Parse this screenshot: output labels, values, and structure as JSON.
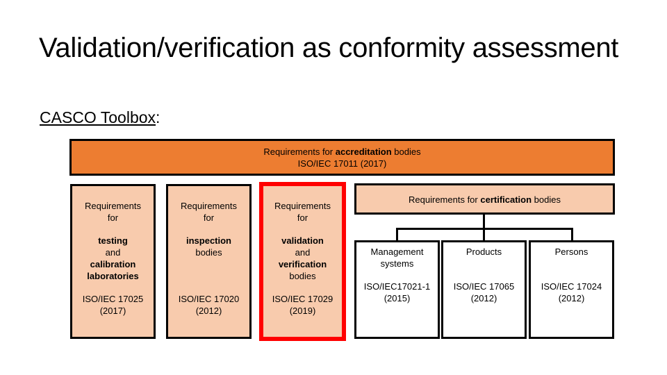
{
  "title": "Validation/verification as conformity assessment",
  "subtitle": {
    "label": "CASCO Toolbox",
    "suffix": ":"
  },
  "diagram": {
    "accreditation": {
      "prefix": "Requirements for ",
      "keyword": "accreditation",
      "suffix": " bodies",
      "standard": "ISO/IEC 17011 (2017)"
    },
    "columns": [
      {
        "intro1": "Requirements",
        "intro2": "for",
        "k1": "testing",
        "mid": "and",
        "k2": "calibration",
        "k3": "laboratories",
        "standard": "ISO/IEC 17025",
        "year": "(2017)"
      },
      {
        "intro1": "Requirements",
        "intro2": "for",
        "k1": "inspection",
        "mid": "bodies",
        "standard": "ISO/IEC 17020",
        "year": "(2012)"
      },
      {
        "intro1": "Requirements",
        "intro2": "for",
        "k1": "validation",
        "mid": "and",
        "k2": "verification",
        "tail": "bodies",
        "standard": "ISO/IEC 17029",
        "year": "(2019)",
        "highlighted": true,
        "highlight_color": "#ff0000"
      }
    ],
    "certification": {
      "prefix": "Requirements for ",
      "keyword": "certification",
      "suffix": " bodies",
      "children": [
        {
          "line1": "Management",
          "line2": "systems",
          "standard": "ISO/IEC17021-1",
          "year": "(2015)"
        },
        {
          "line1": "Products",
          "standard": "ISO/IEC 17065",
          "year": "(2012)"
        },
        {
          "line1": "Persons",
          "standard": "ISO/IEC 17024",
          "year": "(2012)"
        }
      ]
    },
    "colors": {
      "accreditation_fill": "#ed7d31",
      "box_fill": "#f8cbad",
      "highlight_border": "#ff0000",
      "border": "#000000"
    }
  }
}
